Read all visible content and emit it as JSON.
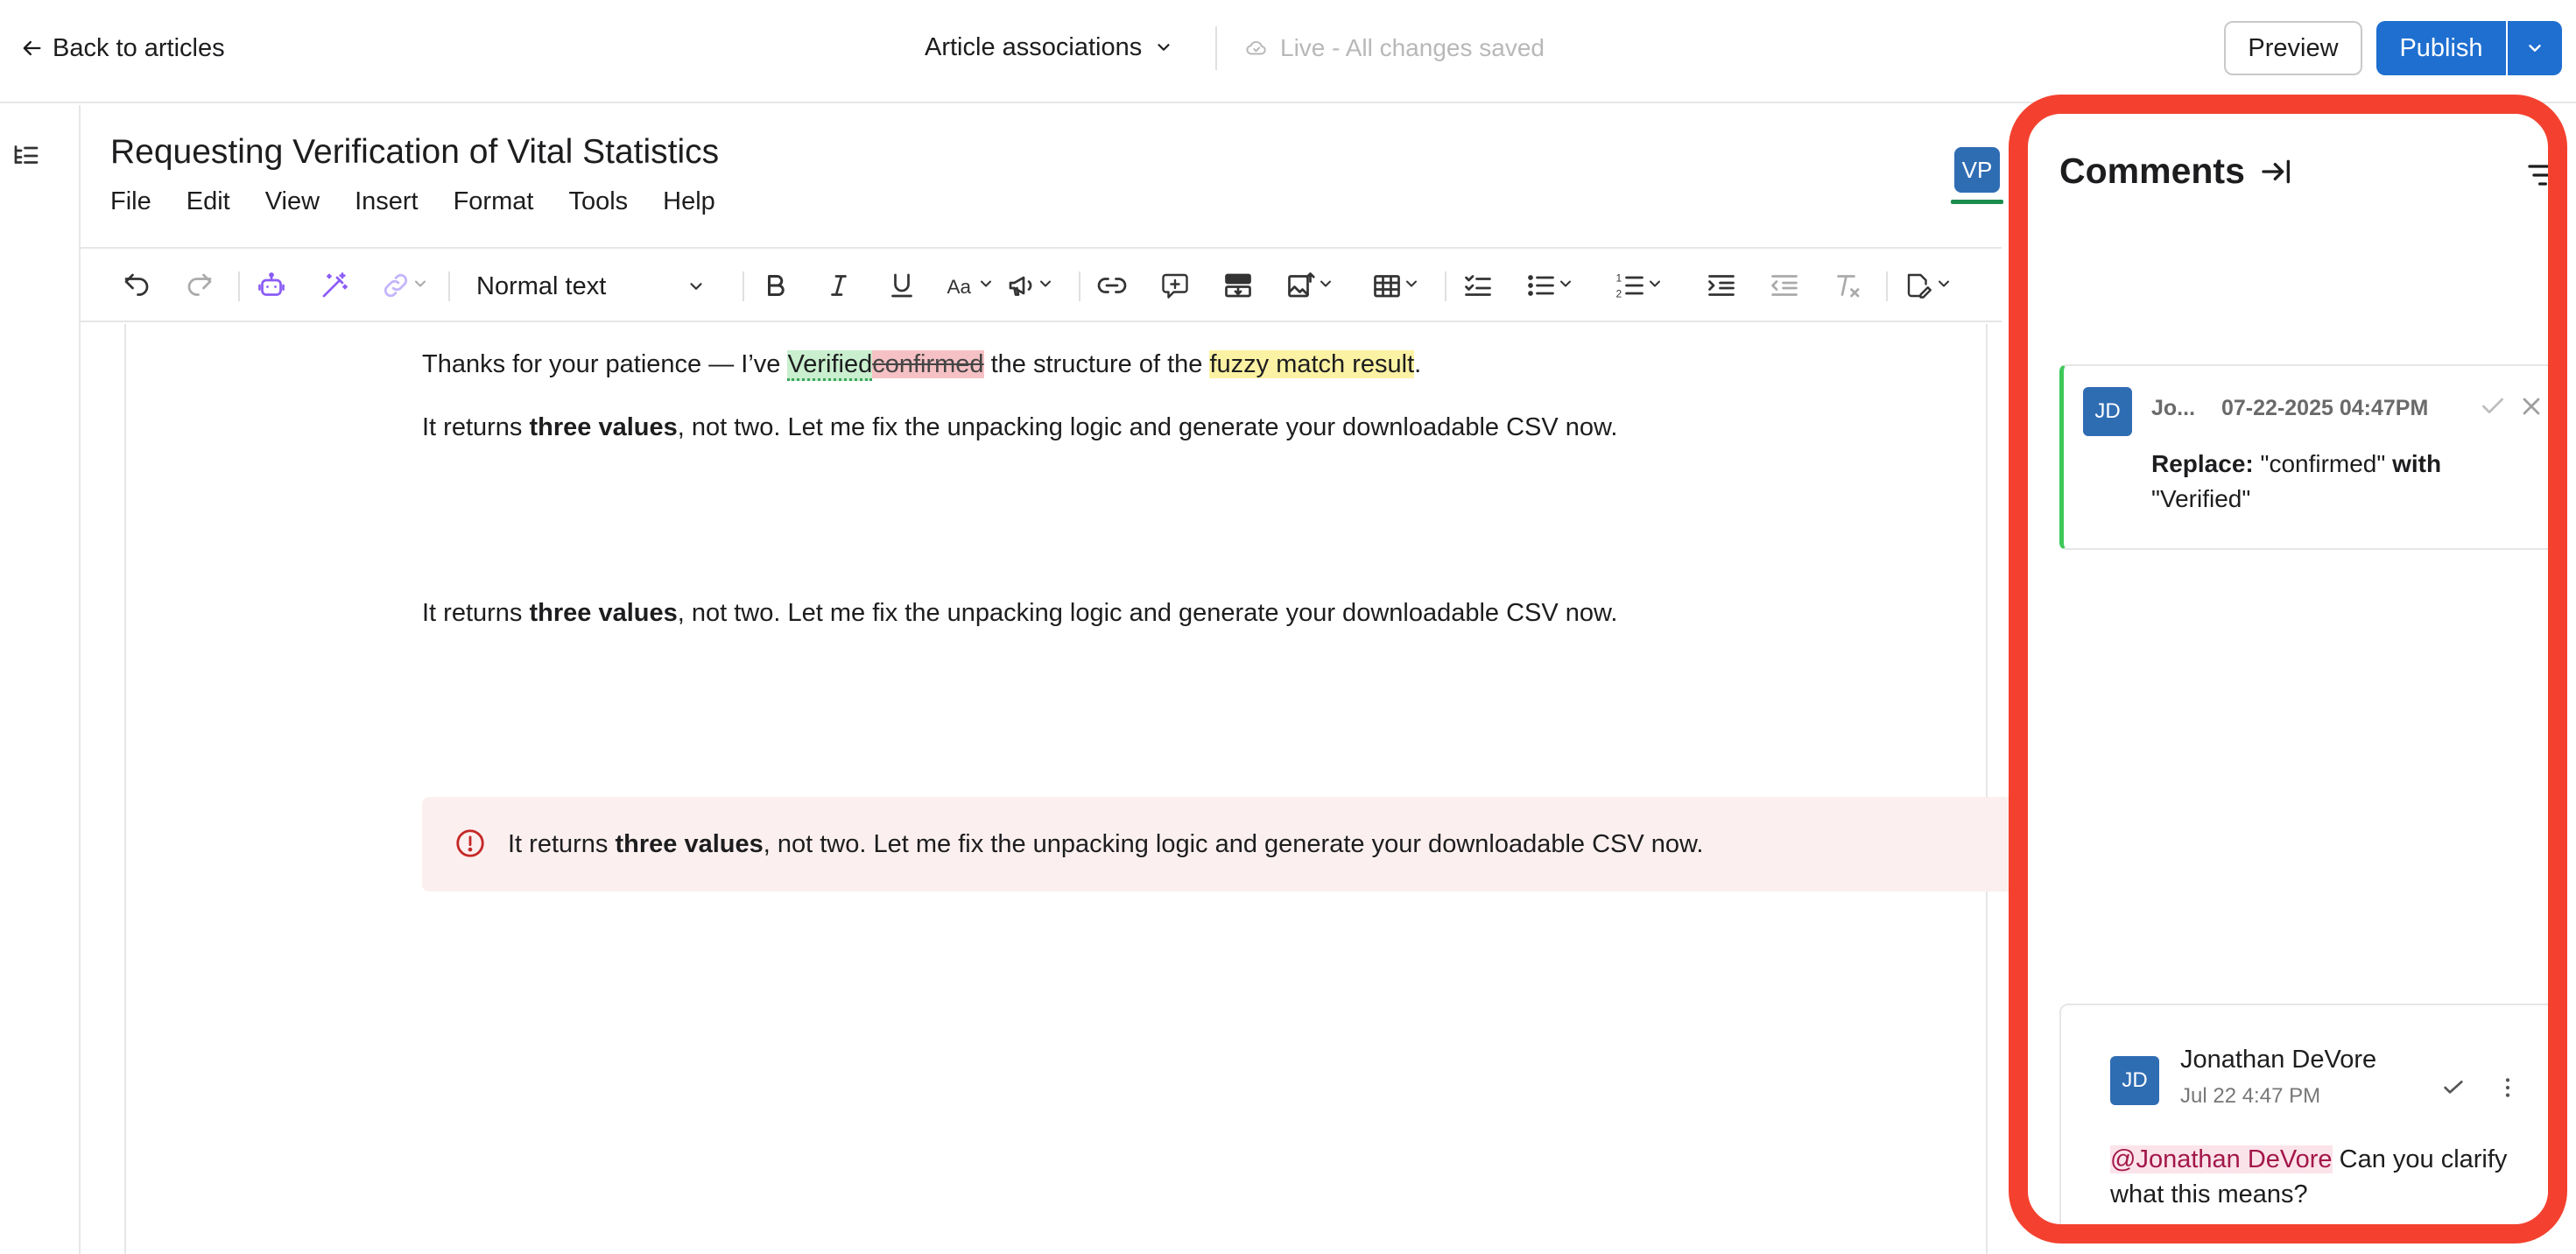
{
  "topbar": {
    "back_label": "Back to articles",
    "associations_label": "Article associations",
    "status_label": "Live - All changes saved",
    "preview_label": "Preview",
    "publish_label": "Publish"
  },
  "document": {
    "title": "Requesting Verification of Vital Statistics",
    "menu": [
      "File",
      "Edit",
      "View",
      "Insert",
      "Format",
      "Tools",
      "Help"
    ],
    "collaborator_initials": "VP",
    "style_select_value": "Normal text",
    "para1": {
      "prefix": "Thanks for your patience — I’ve ",
      "inserted": "Verified",
      "deleted": "confirmed",
      "middle": " the structure of the ",
      "highlight": "fuzzy match result",
      "suffix": "."
    },
    "para2": {
      "prefix": "It returns ",
      "bold": "three values",
      "suffix": ", not two. Let me fix the unpacking logic and generate your downloadable CSV now."
    },
    "callout": {
      "prefix": "It returns ",
      "bold": "three values",
      "suffix": ", not two. Let me fix the unpacking logic and generate your downloadable CSV now."
    },
    "para3": {
      "prefix": "It returns ",
      "bold": "three values",
      "suffix": ", not two. Let me fix the unpacking logic and generate your downloadable CSV now."
    }
  },
  "comments": {
    "title": "Comments",
    "suggestion": {
      "initials": "JD",
      "author": "Jo...",
      "timestamp": "07-22-2025 04:47PM",
      "replace_label": "Replace:",
      "old_text": "\"confirmed\"",
      "with_label": "with",
      "new_text": "\"Verified\""
    },
    "thread": {
      "initials": "JD",
      "author": "Jonathan DeVore",
      "timestamp": "Jul 22 4:47 PM",
      "mention": "@Jonathan DeVore",
      "message": " Can you clarify what this means?"
    }
  },
  "colors": {
    "accent": "#1e6fd0",
    "avatar": "#2f6db3",
    "insert_bg": "#c9efcf",
    "delete_bg": "#f6c1c4",
    "highlight_bg": "#fcf2a3",
    "callout_bg": "#fbf0ef",
    "callout_icon": "#c62828",
    "panel_outline": "#f4412f",
    "suggestion_bar": "#3ec95a",
    "mention": "#a3174a"
  }
}
